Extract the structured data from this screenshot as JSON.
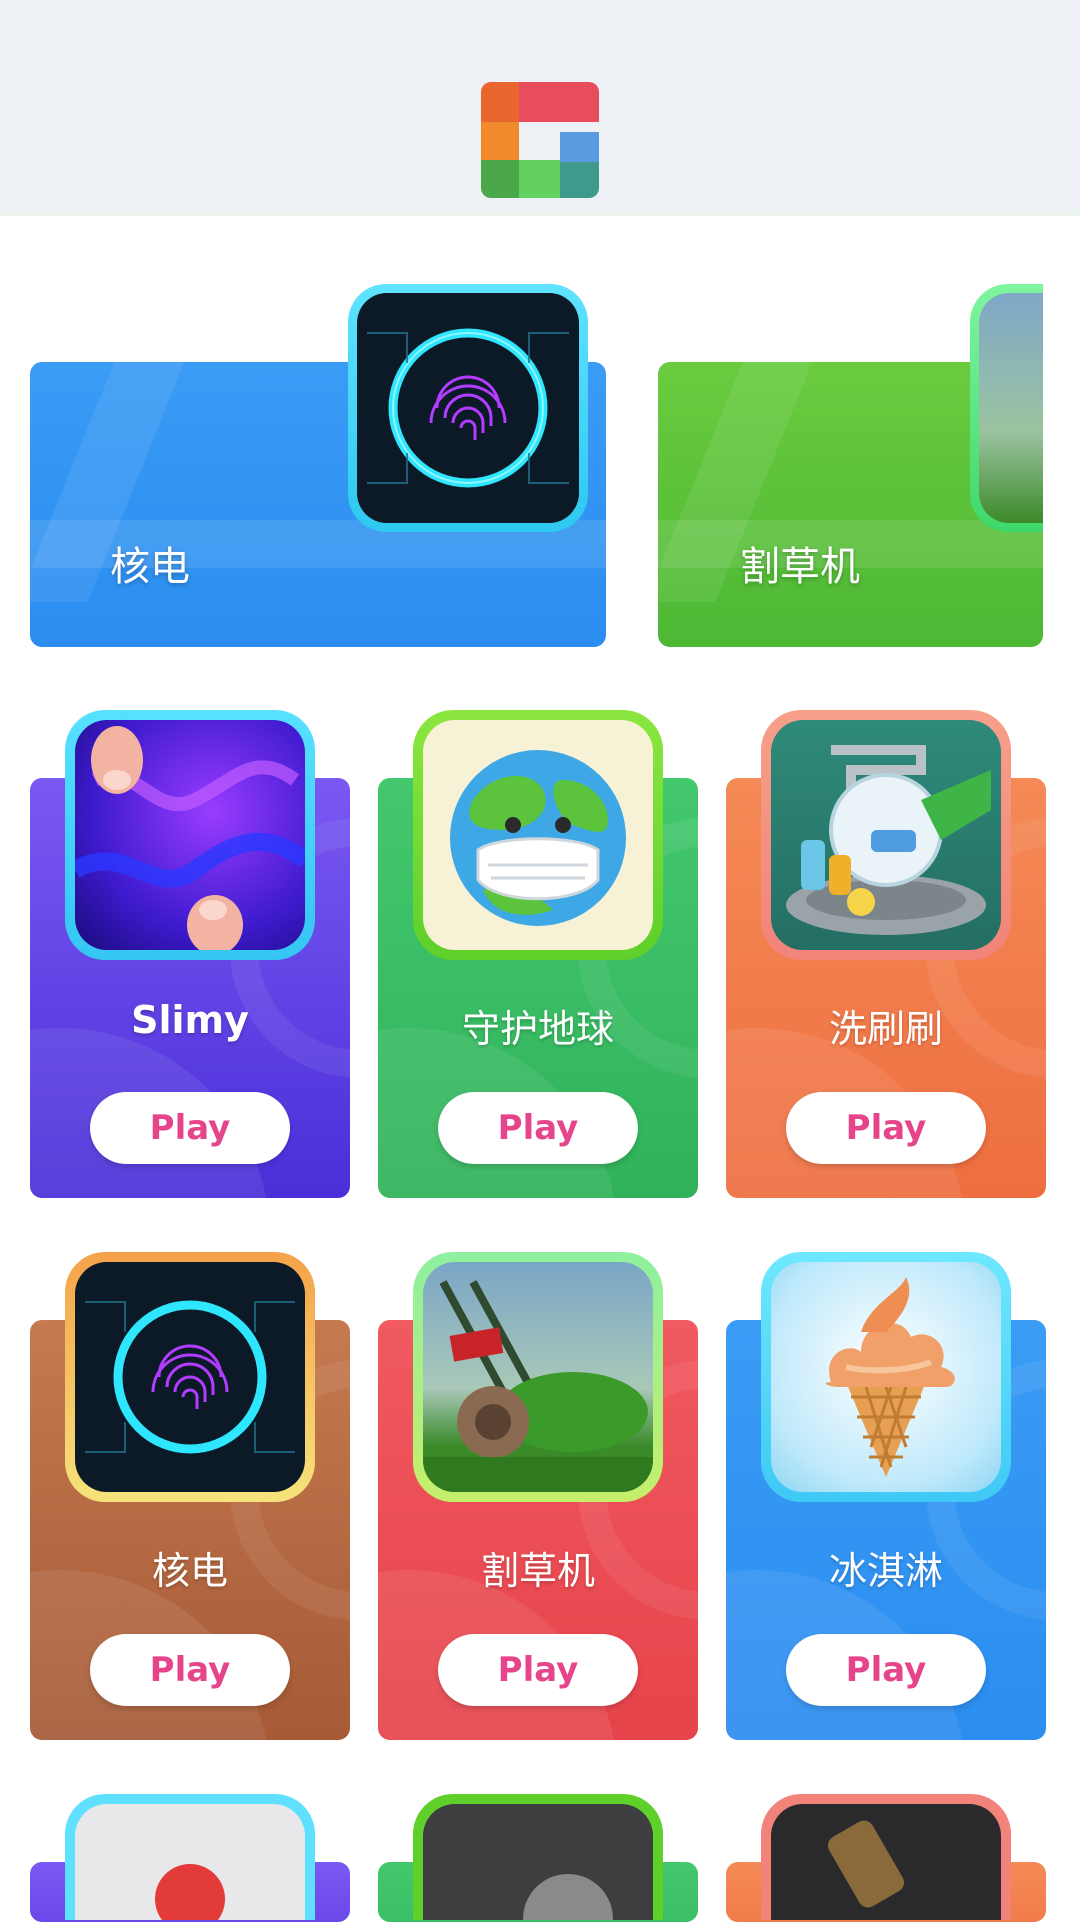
{
  "header": {
    "logo_name": "app-logo"
  },
  "featured": [
    {
      "title": "核电",
      "icon": "fingerprint-icon",
      "color": "#2d95f2"
    },
    {
      "title": "割草机",
      "icon": "lawnmower-icon",
      "color": "#55c23a"
    }
  ],
  "games": [
    {
      "title": "Slimy",
      "button": "Play",
      "icon": "slime-icon",
      "color": "#5a3fe0"
    },
    {
      "title": "守护地球",
      "button": "Play",
      "icon": "earth-mask-icon",
      "color": "#3ac16a"
    },
    {
      "title": "洗刷刷",
      "button": "Play",
      "icon": "dish-washing-icon",
      "color": "#f27b4b"
    },
    {
      "title": "核电",
      "button": "Play",
      "icon": "fingerprint-icon",
      "color": "#b5683f"
    },
    {
      "title": "割草机",
      "button": "Play",
      "icon": "lawnmower-icon",
      "color": "#ec4f55"
    },
    {
      "title": "冰淇淋",
      "button": "Play",
      "icon": "ice-cream-icon",
      "color": "#2d95f2"
    }
  ]
}
